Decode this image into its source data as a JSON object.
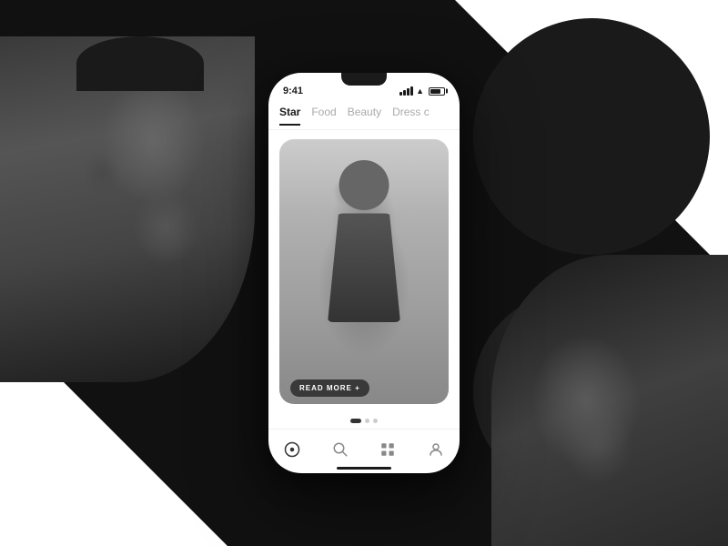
{
  "background": {
    "color": "#111111"
  },
  "phone": {
    "status_bar": {
      "time": "9:41"
    },
    "tabs": [
      {
        "id": "star",
        "label": "Star",
        "active": true
      },
      {
        "id": "food",
        "label": "Food",
        "active": false
      },
      {
        "id": "beauty",
        "label": "Beauty",
        "active": false
      },
      {
        "id": "dress",
        "label": "Dress c",
        "active": false
      }
    ],
    "card": {
      "read_more_label": "READ MORE +"
    },
    "bottom_nav": [
      {
        "id": "explore",
        "icon": "⊙",
        "active": true
      },
      {
        "id": "search",
        "icon": "○"
      },
      {
        "id": "grid",
        "icon": "⊞"
      },
      {
        "id": "profile",
        "icon": "◯"
      }
    ],
    "dots": [
      {
        "active": true
      },
      {
        "active": false
      },
      {
        "active": false
      }
    ]
  }
}
